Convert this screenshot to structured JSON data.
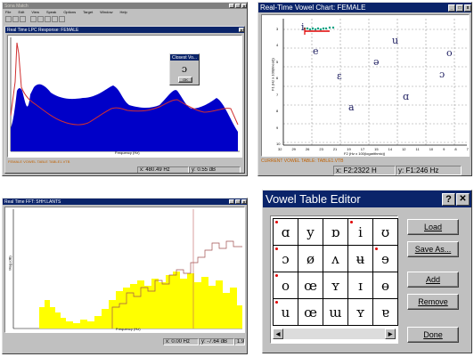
{
  "main_window": {
    "title": "Sona Match",
    "menu": [
      "File",
      "Edit",
      "View",
      "Speak",
      "Options",
      "Target",
      "Window",
      "Help"
    ]
  },
  "lpc_window": {
    "title": "Real Time LPC Response: FEMALE",
    "footer_label": "FEMALE VOWEL TABLE TABLE1.VTB",
    "x_axis_label": "Frequency (Hz)",
    "status_x": "x: 480.49 Hz",
    "status_y": "y: 0.55 dB"
  },
  "dialog": {
    "title": "Closest Vo...",
    "vowel": "ɔ",
    "ok_label": "OK"
  },
  "vowel_chart": {
    "title": "Real-Time Vowel Chart: FEMALE",
    "footer_label": "CURRENT VOWEL TABLE: TABLE1.VTB",
    "x_axis_label": "F2 (Hz x 100(logarithmic))",
    "y_axis_label": "F1 (Hz x 100(linear))",
    "x_ticks": [
      "32",
      "29",
      "26",
      "23",
      "21",
      "19",
      "17",
      "15",
      "14",
      "12",
      "11",
      "10",
      "9",
      "8",
      "7"
    ],
    "y_ticks": [
      "3",
      "4",
      "5",
      "6",
      "7",
      "8",
      "9",
      "10"
    ],
    "status_x": "x: F2:2322 H",
    "status_y": "y: F1:246 Hz",
    "vowels": [
      {
        "symbol": "i"
      },
      {
        "symbol": "e"
      },
      {
        "symbol": "ɛ"
      },
      {
        "symbol": "a"
      },
      {
        "symbol": "ə"
      },
      {
        "symbol": "u"
      },
      {
        "symbol": "o"
      },
      {
        "symbol": "ɔ"
      },
      {
        "symbol": "ɑ"
      }
    ]
  },
  "fft_window": {
    "title": "Real Time FFT: SHH.LANTS",
    "y_axis_label": "Mag (dB)",
    "x_axis_label": "Frequency (Hz)",
    "status_x": "x: 0.00 Hz",
    "status_y": "y: -7.64 dB",
    "status_extra": "1.91"
  },
  "vowel_table_editor": {
    "title": "Vowel Table Editor",
    "help_label": "?",
    "close_label": "✕",
    "cells": [
      "ɑ",
      "y",
      "ɒ",
      "i",
      "ʊ",
      "ɔ",
      "ø",
      "ʌ",
      "ʉ",
      "ɘ",
      "o",
      "œ",
      "ʏ",
      "ɪ",
      "ɵ",
      "u",
      "œ",
      "ɯ",
      "ʏ",
      "ɐ"
    ],
    "marked": [
      true,
      false,
      false,
      true,
      false,
      true,
      false,
      false,
      false,
      true,
      true,
      false,
      false,
      false,
      false,
      true,
      false,
      false,
      false,
      false
    ],
    "buttons": {
      "load": "Load",
      "save_as": "Save As...",
      "add": "Add",
      "remove": "Remove",
      "done": "Done"
    }
  },
  "colors": {
    "lpc_fill": "#0000c8",
    "lpc_line": "#d03030",
    "fft_fill": "#ffff00",
    "fft_line": "#a05050",
    "title_active": "#0a246a",
    "marker": "#e00000",
    "trail": "#00a080"
  }
}
